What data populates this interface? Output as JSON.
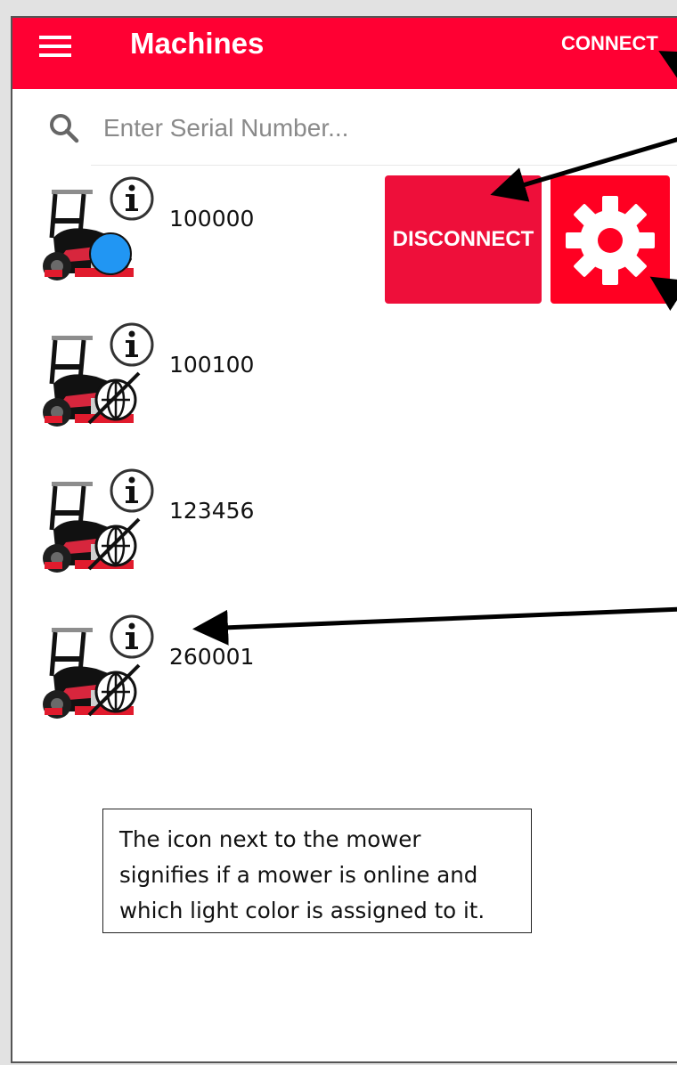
{
  "appbar": {
    "menu_icon": "hamburger-menu-icon",
    "title": "Machines",
    "connect_label": "CONNECT",
    "color": "#ff0033"
  },
  "search": {
    "icon": "search-icon",
    "placeholder": "Enter Serial Number..."
  },
  "machines": [
    {
      "serial": "100000",
      "status": "online",
      "light_color": "#2196f3"
    },
    {
      "serial": "100100",
      "status": "offline"
    },
    {
      "serial": "123456",
      "status": "offline"
    },
    {
      "serial": "260001",
      "status": "offline"
    }
  ],
  "actions": {
    "disconnect_label": "DISCONNECT",
    "settings_icon": "gear-icon"
  },
  "note": {
    "lines": [
      "The icon next to the mower",
      "signifies if a mower is online and",
      "which light color is assigned to it."
    ]
  }
}
